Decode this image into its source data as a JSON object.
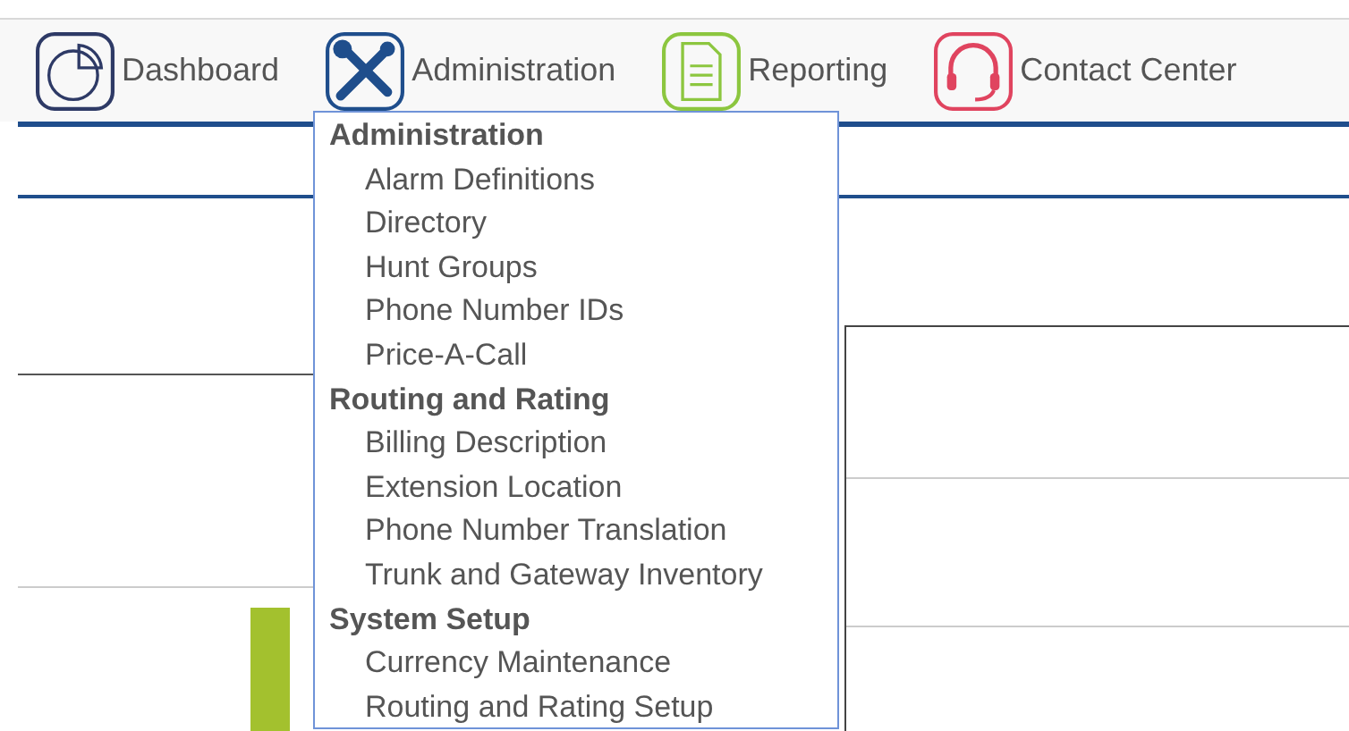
{
  "nav": [
    {
      "kind": "dashboard",
      "label": "Dashboard"
    },
    {
      "kind": "tools",
      "label": "Administration"
    },
    {
      "kind": "document",
      "label": "Reporting"
    },
    {
      "kind": "headset",
      "label": "Contact Center"
    }
  ],
  "menu": {
    "sections": [
      {
        "title": "Administration",
        "items": [
          "Alarm Definitions",
          "Directory",
          "Hunt Groups",
          "Phone Number IDs",
          "Price-A-Call"
        ]
      },
      {
        "title": "Routing and Rating",
        "items": [
          "Billing Description",
          "Extension Location",
          "Phone Number Translation",
          "Trunk and Gateway Inventory"
        ]
      },
      {
        "title": "System Setup",
        "items": [
          "Currency Maintenance",
          "Routing and Rating Setup"
        ]
      }
    ]
  }
}
